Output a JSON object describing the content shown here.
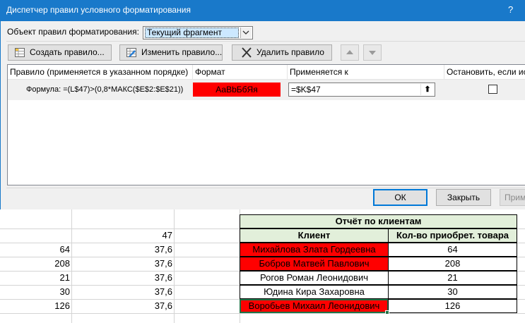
{
  "dialog": {
    "title": "Диспетчер правил условного форматирования",
    "help": "?",
    "object_label": "Объект правил форматирования:",
    "object_value": "Текущий фрагмент",
    "buttons": {
      "create": "Создать правило...",
      "edit": "Изменить правило...",
      "delete": "Удалить правило"
    },
    "columns": [
      "Правило (применяется в указанном порядке)",
      "Формат",
      "Применяется к",
      "Остановить, если ист"
    ],
    "rule": {
      "formula": "Формула: =(L$47)>(0,8*МАКС($E$2:$E$21))",
      "preview": "АаВbБбЯя",
      "applies_to": "=$K$47"
    },
    "ok": "ОК",
    "close": "Закрыть",
    "apply": "Прим"
  },
  "sheet": {
    "col_a": [
      "",
      "64",
      "208",
      "21",
      "30",
      "126"
    ],
    "col_b": [
      "47",
      "37,6",
      "37,6",
      "37,6",
      "37,6",
      "37,6"
    ],
    "table": {
      "title": "Отчёт по клиентам",
      "headers": [
        "Клиент",
        "Кол-во приобрет. товара"
      ],
      "rows": [
        {
          "client": "Михайлова Злата Гордеевна",
          "qty": "64",
          "highlight": true
        },
        {
          "client": "Бобров Матвей Павлович",
          "qty": "208",
          "highlight": true
        },
        {
          "client": "Рогов Роман Леонидович",
          "qty": "21",
          "highlight": false
        },
        {
          "client": "Юдина Кира Захаровна",
          "qty": "30",
          "highlight": false
        },
        {
          "client": "Воробьев Михаил Леонидович",
          "qty": "126",
          "highlight": true
        }
      ]
    }
  },
  "colors": {
    "titlebar": "#1979ca",
    "highlight": "#ff0000",
    "table_header": "#e2efda"
  }
}
